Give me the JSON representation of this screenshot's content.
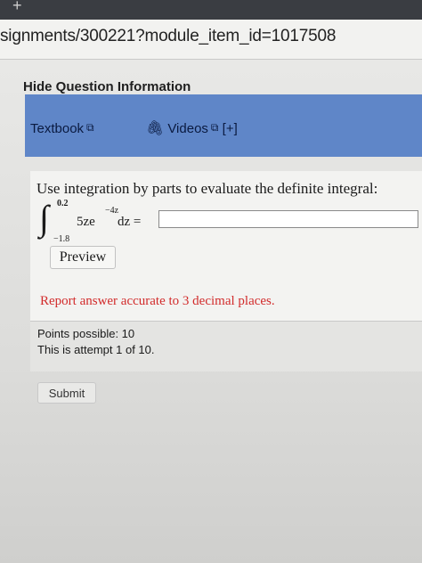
{
  "browser": {
    "url": "signments/300221?module_item_id=1017508",
    "tab_plus": "+"
  },
  "question_info": {
    "hide_label": "Hide Question Information"
  },
  "help_bar": {
    "textbook_label": "Textbook",
    "external_icon": "external-link-icon",
    "videos_label": "Videos",
    "videos_expand": "[+]",
    "clip_icon": "paperclip-icon",
    "background": "#5f86c8"
  },
  "question": {
    "prompt": "Use integration by parts to evaluate the definite integral:",
    "integral_upper": "0.2",
    "integral_lower": "−1.8",
    "integrand": "5ze",
    "exponent": "−4z",
    "differential": "dz =",
    "answer_value": "",
    "preview_label": "Preview",
    "report_note": "Report answer accurate to 3 decimal places.",
    "note_color": "#d22b2b"
  },
  "points": {
    "possible": "Points possible: 10",
    "attempt": "This is attempt 1 of 10."
  },
  "submit_label": "Submit"
}
